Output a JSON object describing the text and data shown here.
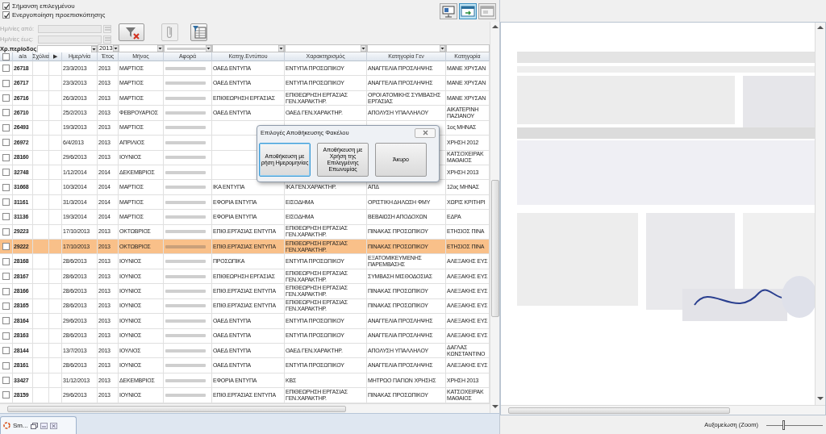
{
  "options": [
    {
      "label": "Σήμανση επιλεγμένου",
      "checked": true
    },
    {
      "label": "Ενεργοποίηση προεπισκόπησης",
      "checked": true
    }
  ],
  "viewer_toolbar": [
    {
      "kind": "screen",
      "active": false
    },
    {
      "kind": "export",
      "active": true
    },
    {
      "kind": "window",
      "active": false
    }
  ],
  "date_filter": {
    "from_label": "Ημ/νίες από:",
    "to_label": "Ημ/νίες έως:",
    "disabled": true
  },
  "filter_buttons": [
    {
      "kind": "filter-clear",
      "disabled": false
    },
    {
      "kind": "attach",
      "disabled": true
    },
    {
      "kind": "filter-table",
      "disabled": false
    }
  ],
  "period": {
    "label": "Χρ.περίοδος:",
    "year": "2013"
  },
  "header_checked": false,
  "columns": [
    "a/a",
    "Σχόλια",
    "▶",
    "Ημερ/νία",
    "Έτος",
    "Μήνος",
    "Αφορά",
    "Κατηγ.Εντύπου",
    "Χαρακτηρισμός",
    "Κατηγορία Γεν",
    "Κατηγορία"
  ],
  "rows": [
    {
      "aa": "26718",
      "date": "23/3/2013",
      "year": "2013",
      "month": "ΜΑΡΤΙΟΣ",
      "form_category": "ΟΑΕΔ ΕΝΤΥΠΑ",
      "characterization": "ΕΝΤΥΠΑ ΠΡΟΣΩΠΙΚΟΥ",
      "general_category": "ΑΝΑΓΓΕΛΙΑ ΠΡΟΣΛΗΨΗΣ",
      "category": "ΜΑΝΕ ΧΡΥΣΑΝ",
      "checked": false,
      "selected": false
    },
    {
      "aa": "26717",
      "date": "23/3/2013",
      "year": "2013",
      "month": "ΜΑΡΤΙΟΣ",
      "form_category": "ΟΑΕΔ ΕΝΤΥΠΑ",
      "characterization": "ΕΝΤΥΠΑ ΠΡΟΣΩΠΙΚΟΥ",
      "general_category": "ΑΝΑΓΓΕΛΙΑ ΠΡΟΣΛΗΨΗΣ",
      "category": "ΜΑΝΕ ΧΡΥΣΑΝ",
      "checked": false,
      "selected": false
    },
    {
      "aa": "26716",
      "date": "26/3/2013",
      "year": "2013",
      "month": "ΜΑΡΤΙΟΣ",
      "form_category": "ΕΠΙΘΕΩΡΗΣΗ ΕΡΓΑΣΙΑΣ",
      "characterization": "ΕΠΙΘΕΩΡΗΣΗ ΕΡΓΑΣΙΑΣ ΓΕΝ.ΧΑΡΑΚΤΗΡ.",
      "general_category": "ΟΡΟΙ ΑΤΟΜΙΚΗΣ ΣΥΜΒΑΣΗΣ ΕΡΓΑΣΙΑΣ",
      "category": "ΜΑΝΕ ΧΡΥΣΑΝ",
      "checked": false,
      "selected": false
    },
    {
      "aa": "26710",
      "date": "25/2/2013",
      "year": "2013",
      "month": "ΦΕΒΡΟΥΑΡΙΟΣ",
      "form_category": "ΟΑΕΔ ΕΝΤΥΠΑ",
      "characterization": "ΟΑΕΔ ΓΕΝ.ΧΑΡΑΚΤΗΡ.",
      "general_category": "ΑΠΟΛΥΣΗ ΥΠΑΛΛΗΛΟΥ",
      "category": "ΑΙΚΑΤΕΡΙΝΗ ΠΑΖΙΑΝΟΥ",
      "checked": false,
      "selected": false
    },
    {
      "aa": "26493",
      "date": "19/3/2013",
      "year": "2013",
      "month": "ΜΑΡΤΙΟΣ",
      "category": "1ος ΜΗΝΑΣ",
      "checked": false,
      "selected": false
    },
    {
      "aa": "26972",
      "date": "6/4/2013",
      "year": "2013",
      "month": "ΑΠΡΙΛΙΟΣ",
      "category": "ΧΡΗΣΗ 2012",
      "checked": false,
      "selected": false
    },
    {
      "aa": "28160",
      "date": "29/6/2013",
      "year": "2013",
      "month": "ΙΟΥΝΙΟΣ",
      "category": "ΚΑΤΣΟΧΕΙΡΑΚ ΜΑΘΑΙΟΣ",
      "checked": false,
      "selected": false
    },
    {
      "aa": "32748",
      "date": "1/12/2014",
      "year": "2014",
      "month": "ΔΕΚΕΜΒΡΙΟΣ",
      "category": "ΧΡΗΣΗ 2013",
      "checked": false,
      "selected": false
    },
    {
      "aa": "31668",
      "date": "10/3/2014",
      "year": "2014",
      "month": "ΜΑΡΤΙΟΣ",
      "form_category": "ΙΚΑ ΕΝΤΥΠΑ",
      "characterization": "ΙΚΑ ΓΕΝ.ΧΑΡΑΚΤΗΡ.",
      "general_category": "ΑΠΔ",
      "category": "12ος ΜΗΝΑΣ",
      "checked": false,
      "selected": false
    },
    {
      "aa": "31161",
      "date": "31/3/2014",
      "year": "2014",
      "month": "ΜΑΡΤΙΟΣ",
      "form_category": "ΕΦΟΡΙΑ ΕΝΤΥΠΑ",
      "characterization": "ΕΙΣΟΔΗΜΑ",
      "general_category": "ΟΡΙΣΤΙΚΗ ΔΗΛΩΣΗ ΦΜΥ",
      "category": "ΧΩΡΙΣ ΚΡΙΤΗΡΙ",
      "checked": false,
      "selected": false
    },
    {
      "aa": "31136",
      "date": "19/3/2014",
      "year": "2014",
      "month": "ΜΑΡΤΙΟΣ",
      "form_category": "ΕΦΟΡΙΑ ΕΝΤΥΠΑ",
      "characterization": "ΕΙΣΟΔΗΜΑ",
      "general_category": "ΒΕΒΑΙΩΣΗ ΑΠΟΔΟΧΩΝ",
      "category": "ΕΔΡΑ",
      "checked": false,
      "selected": false
    },
    {
      "aa": "29223",
      "date": "17/10/2013",
      "year": "2013",
      "month": "ΟΚΤΩΒΡΙΟΣ",
      "form_category": "ΕΠΙΘ.ΕΡΓΑΣΙΑΣ ΕΝΤΥΠΑ",
      "characterization": "ΕΠΙΘΕΩΡΗΣΗ ΕΡΓΑΣΙΑΣ ΓΕΝ.ΧΑΡΑΚΤΗΡ.",
      "general_category": "ΠΙΝΑΚΑΣ ΠΡΟΣΩΠΙΚΟΥ",
      "category": "ΕΤΗΣΙΟΣ ΠΙΝΑ",
      "checked": false,
      "selected": false
    },
    {
      "aa": "29222",
      "date": "17/10/2013",
      "year": "2013",
      "month": "ΟΚΤΩΒΡΙΟΣ",
      "form_category": "ΕΠΙΘ.ΕΡΓΑΣΙΑΣ ΕΝΤΥΠΑ",
      "characterization": "ΕΠΙΘΕΩΡΗΣΗ ΕΡΓΑΣΙΑΣ ΓΕΝ.ΧΑΡΑΚΤΗΡ.",
      "general_category": "ΠΙΝΑΚΑΣ ΠΡΟΣΩΠΙΚΟΥ",
      "category": "ΕΤΗΣΙΟΣ ΠΙΝΑ",
      "checked": false,
      "selected": true
    },
    {
      "aa": "28168",
      "date": "28/6/2013",
      "year": "2013",
      "month": "ΙΟΥΝΙΟΣ",
      "form_category": "ΠΡΟΣΩΠΙΚΑ",
      "characterization": "ΕΝΤΥΠΑ ΠΡΟΣΩΠΙΚΟΥ",
      "general_category": "ΕΞΑΤΟΜΙΚΕΥΜΕΝΗΣ ΠΑΡΕΜΒΑΣΗΣ",
      "category": "ΑΛΕΞΑΚΗΣ ΕΥΣ",
      "checked": false,
      "selected": false
    },
    {
      "aa": "28167",
      "date": "28/6/2013",
      "year": "2013",
      "month": "ΙΟΥΝΙΟΣ",
      "form_category": "ΕΠΙΘΕΩΡΗΣΗ ΕΡΓΑΣΙΑΣ",
      "characterization": "ΕΠΙΘΕΩΡΗΣΗ ΕΡΓΑΣΙΑΣ ΓΕΝ.ΧΑΡΑΚΤΗΡ.",
      "general_category": "ΣΥΜΒΑΣΗ ΜΙΣΘΟΔΟΣΙΑΣ",
      "category": "ΑΛΕΞΑΚΗΣ ΕΥΣ",
      "checked": false,
      "selected": false
    },
    {
      "aa": "28166",
      "date": "28/6/2013",
      "year": "2013",
      "month": "ΙΟΥΝΙΟΣ",
      "form_category": "ΕΠΙΘ.ΕΡΓΑΣΙΑΣ ΕΝΤΥΠΑ",
      "characterization": "ΕΠΙΘΕΩΡΗΣΗ ΕΡΓΑΣΙΑΣ ΓΕΝ.ΧΑΡΑΚΤΗΡ.",
      "general_category": "ΠΙΝΑΚΑΣ ΠΡΟΣΩΠΙΚΟΥ",
      "category": "ΑΛΕΞΑΚΗΣ ΕΥΣ",
      "checked": false,
      "selected": false
    },
    {
      "aa": "28165",
      "date": "28/6/2013",
      "year": "2013",
      "month": "ΙΟΥΝΙΟΣ",
      "form_category": "ΕΠΙΘ.ΕΡΓΑΣΙΑΣ ΕΝΤΥΠΑ",
      "characterization": "ΕΠΙΘΕΩΡΗΣΗ ΕΡΓΑΣΙΑΣ ΓΕΝ.ΧΑΡΑΚΤΗΡ.",
      "general_category": "ΠΙΝΑΚΑΣ ΠΡΟΣΩΠΙΚΟΥ",
      "category": "ΑΛΕΞΑΚΗΣ ΕΥΣ",
      "checked": false,
      "selected": false
    },
    {
      "aa": "28164",
      "date": "29/6/2013",
      "year": "2013",
      "month": "ΙΟΥΝΙΟΣ",
      "form_category": "ΟΑΕΔ ΕΝΤΥΠΑ",
      "characterization": "ΕΝΤΥΠΑ ΠΡΟΣΩΠΙΚΟΥ",
      "general_category": "ΑΝΑΓΓΕΛΙΑ ΠΡΟΣΛΗΨΗΣ",
      "category": "ΑΛΕΞΑΚΗΣ ΕΥΣ",
      "checked": false,
      "selected": false
    },
    {
      "aa": "28163",
      "date": "28/6/2013",
      "year": "2013",
      "month": "ΙΟΥΝΙΟΣ",
      "form_category": "ΟΑΕΔ ΕΝΤΥΠΑ",
      "characterization": "ΕΝΤΥΠΑ ΠΡΟΣΩΠΙΚΟΥ",
      "general_category": "ΑΝΑΓΓΕΛΙΑ ΠΡΟΣΛΗΨΗΣ",
      "category": "ΑΛΕΞΑΚΗΣ ΕΥΣ",
      "checked": false,
      "selected": false
    },
    {
      "aa": "28144",
      "date": "13/7/2013",
      "year": "2013",
      "month": "ΙΟΥΛΙΟΣ",
      "form_category": "ΟΑΕΔ ΕΝΤΥΠΑ",
      "characterization": "ΟΑΕΔ ΓΕΝ.ΧΑΡΑΚΤΗΡ.",
      "general_category": "ΑΠΟΛΥΣΗ ΥΠΑΛΛΗΛΟΥ",
      "category": "ΔΑΓΛΑΣ ΚΩΝΣΤΑΝΤΙΝΟ",
      "checked": false,
      "selected": false
    },
    {
      "aa": "28161",
      "date": "28/6/2013",
      "year": "2013",
      "month": "ΙΟΥΝΙΟΣ",
      "form_category": "ΟΑΕΔ ΕΝΤΥΠΑ",
      "characterization": "ΕΝΤΥΠΑ ΠΡΟΣΩΠΙΚΟΥ",
      "general_category": "ΑΝΑΓΓΕΛΙΑ ΠΡΟΣΛΗΨΗΣ",
      "category": "ΑΛΕΞΑΚΗΣ ΕΥΣ",
      "checked": false,
      "selected": false
    },
    {
      "aa": "33427",
      "date": "31/12/2013",
      "year": "2013",
      "month": "ΔΕΚΕΜΒΡΙΟΣ",
      "form_category": "ΕΦΟΡΙΑ ΕΝΤΥΠΑ",
      "characterization": "ΚΒΣ",
      "general_category": "ΜΗΤΡΩΟ ΠΑΓΙΩΝ ΧΡΗΣΗΣ",
      "category": "ΧΡΗΣΗ 2013",
      "checked": false,
      "selected": false
    },
    {
      "aa": "28159",
      "date": "29/6/2013",
      "year": "2013",
      "month": "ΙΟΥΝΙΟΣ",
      "form_category": "ΕΠΙΘ.ΕΡΓΑΣΙΑΣ ΕΝΤΥΠΑ",
      "characterization": "ΕΠΙΘΕΩΡΗΣΗ ΕΡΓΑΣΙΑΣ ΓΕΝ.ΧΑΡΑΚΤΗΡ.",
      "general_category": "ΠΙΝΑΚΑΣ ΠΡΟΣΩΠΙΚΟΥ",
      "category": "ΚΑΤΣΟΧΕΙΡΑΚ ΜΑΘΑΙΟΣ",
      "checked": false,
      "selected": false
    }
  ],
  "dialog": {
    "title": "Επιλογές Αποθήκευσης Φακέλου",
    "buttons": [
      {
        "label": "Αποθήκευση με ρήση Ημερομηνίας",
        "focused": true
      },
      {
        "label": "Αποθήκευση με Χρήση της Επιλεγμένης Επωνυμίας",
        "focused": false
      },
      {
        "label": "Άκυρο",
        "focused": false
      }
    ]
  },
  "zoom": {
    "label": "Αυξομείωση (Zoom)",
    "level": 0.3
  },
  "taskbar": {
    "title": "Sm..."
  }
}
